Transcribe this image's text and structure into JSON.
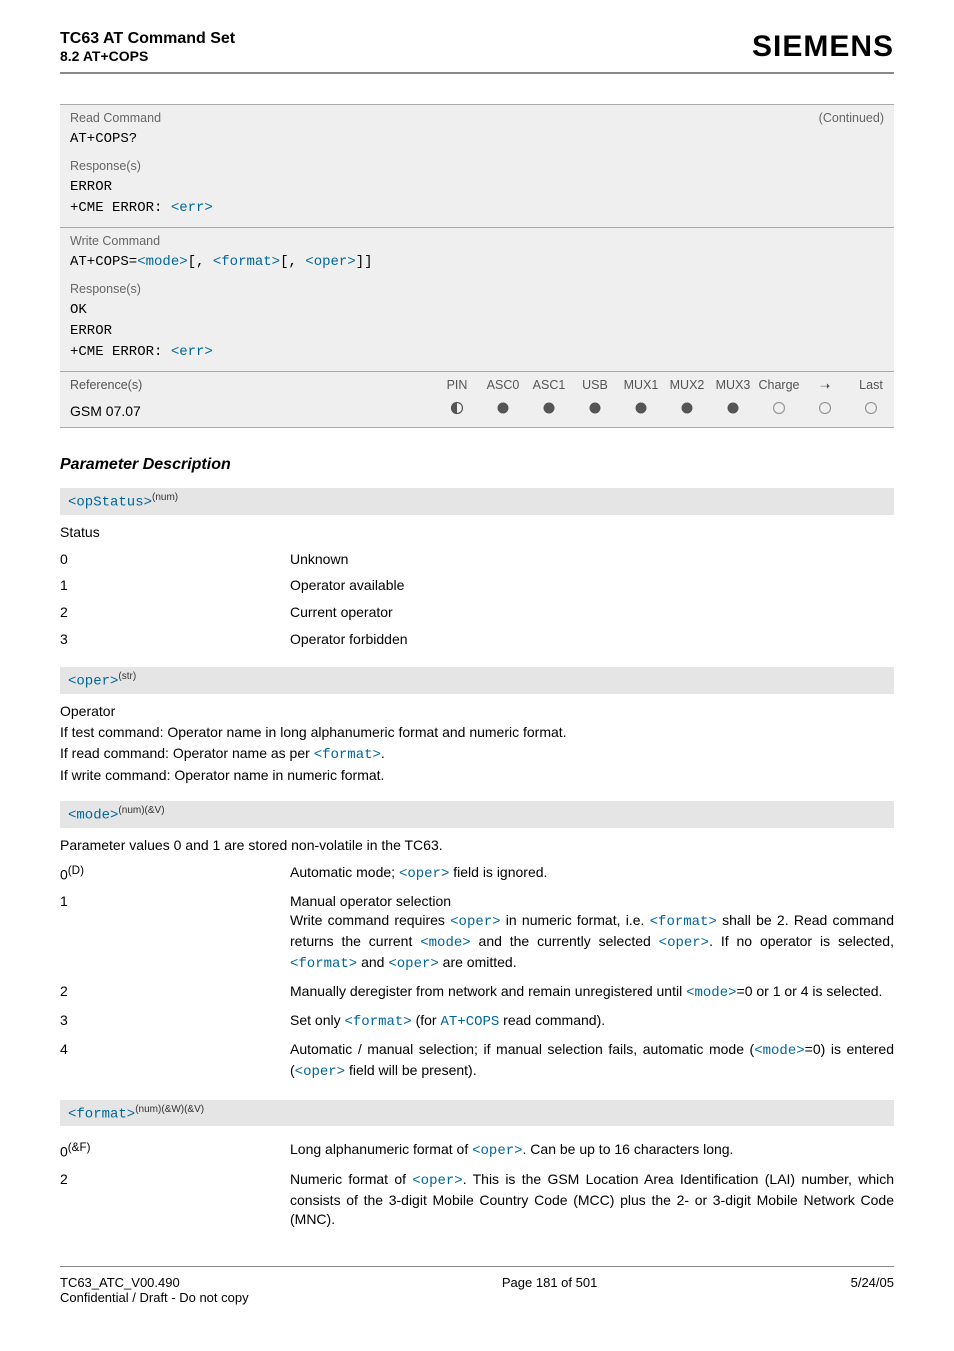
{
  "header": {
    "title": "TC63 AT Command Set",
    "subtitle": "8.2 AT+COPS",
    "logo": "SIEMENS"
  },
  "read_block": {
    "label": "Read Command",
    "continued": "(Continued)",
    "syntax": "AT+COPS?",
    "resp_label": "Response(s)",
    "resp_l1": "ERROR",
    "resp_l2a": "+CME ERROR: ",
    "resp_l2b": "<err>"
  },
  "write_block": {
    "label": "Write Command",
    "syn_a": "AT+COPS=",
    "syn_b": "<mode>",
    "syn_c": "[, ",
    "syn_d": "<format>",
    "syn_e": "[, ",
    "syn_f": "<oper>",
    "syn_g": "]]",
    "resp_label": "Response(s)",
    "resp_l1": "OK",
    "resp_l2": "ERROR",
    "resp_l3a": "+CME ERROR: ",
    "resp_l3b": "<err>"
  },
  "refs": {
    "label": "Reference(s)",
    "cols": [
      "PIN",
      "ASC0",
      "ASC1",
      "USB",
      "MUX1",
      "MUX2",
      "MUX3",
      "Charge",
      "➝",
      "Last"
    ],
    "name": "GSM 07.07",
    "icons": [
      "half",
      "full",
      "full",
      "full",
      "full",
      "full",
      "full",
      "empty",
      "empty",
      "empty"
    ]
  },
  "section_title": "Parameter Description",
  "p_opstatus": {
    "name": "<opStatus>",
    "sup": "(num)",
    "label": "Status",
    "rows": [
      {
        "k": "0",
        "v": "Unknown"
      },
      {
        "k": "1",
        "v": "Operator available"
      },
      {
        "k": "2",
        "v": "Current operator"
      },
      {
        "k": "3",
        "v": "Operator forbidden"
      }
    ]
  },
  "p_oper": {
    "name": "<oper>",
    "sup": "(str)",
    "label": "Operator",
    "l1": "If test command: Operator name in long alphanumeric format and numeric format.",
    "l2a": "If read command: Operator name as per ",
    "l2b": "<format>",
    "l2c": ".",
    "l3": "If write command: Operator name in numeric format."
  },
  "p_mode": {
    "name": "<mode>",
    "sup": "(num)(&V)",
    "intro": "Parameter values 0 and 1 are stored non-volatile in the TC63.",
    "r0": {
      "k": "0",
      "ks": "(D)",
      "a": "Automatic mode; ",
      "b": "<oper>",
      "c": " field is ignored."
    },
    "r1": {
      "k": "1",
      "l1": "Manual operator selection",
      "l2a": "Write command requires ",
      "l2b": "<oper>",
      "l2c": " in numeric format, i.e. ",
      "l2d": "<format>",
      "l2e": " shall be 2.",
      "l3a": "Read command returns the current ",
      "l3b": "<mode>",
      "l3c": " and the currently selected ",
      "l3d": "<oper>",
      "l3e": ". If no operator is selected, ",
      "l3f": "<format>",
      "l3g": " and ",
      "l3h": "<oper>",
      "l3i": " are omitted."
    },
    "r2": {
      "k": "2",
      "a": "Manually deregister from network and remain unregistered until ",
      "b": "<mode>",
      "c": "=0 or 1 or 4 is selected."
    },
    "r3": {
      "k": "3",
      "a": "Set only ",
      "b": "<format>",
      "c": " (for ",
      "d": "AT+COPS",
      "e": " read command)."
    },
    "r4": {
      "k": "4",
      "a": "Automatic / manual selection; if manual selection fails, automatic mode (",
      "b": "<mode>",
      "c": "=0) is entered (",
      "d": "<oper>",
      "e": " field will be present)."
    }
  },
  "p_format": {
    "name": "<format>",
    "sup": "(num)(&W)(&V)",
    "r0": {
      "k": "0",
      "ks": "(&F)",
      "a": "Long alphanumeric format of ",
      "b": "<oper>",
      "c": ". Can be up to 16 characters long."
    },
    "r2": {
      "k": "2",
      "a": "Numeric format of ",
      "b": "<oper>",
      "c": ". This is the GSM Location Area Identification (LAI) number, which consists of the 3-digit Mobile Country Code (MCC) plus the 2- or 3-digit Mobile Network Code (MNC)."
    }
  },
  "footer": {
    "left1": "TC63_ATC_V00.490",
    "left2": "Confidential / Draft - Do not copy",
    "center": "Page 181 of 501",
    "right": "5/24/05"
  }
}
